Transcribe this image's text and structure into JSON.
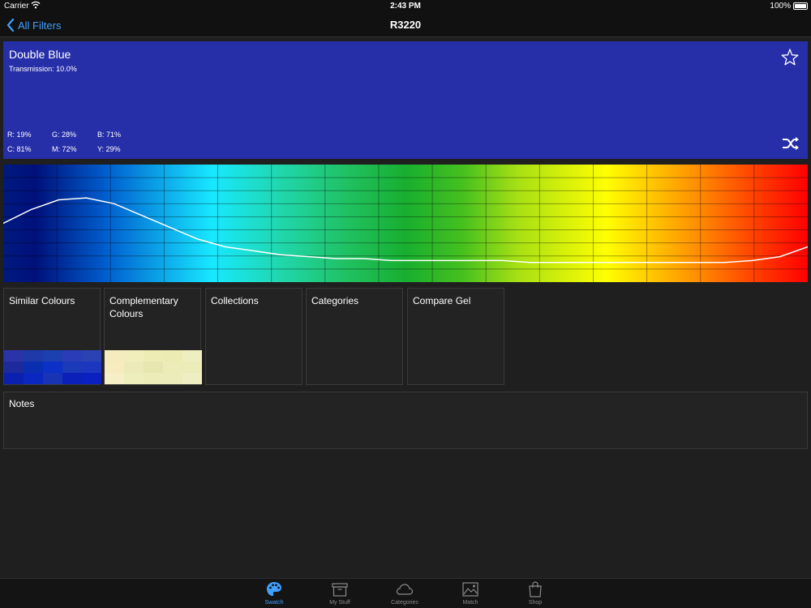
{
  "status_bar": {
    "carrier": "Carrier",
    "time": "2:43 PM",
    "battery": "100%"
  },
  "nav": {
    "back_label": "All Filters",
    "title": "R3220"
  },
  "swatch": {
    "name": "Double Blue",
    "transmission": "Transmission: 10.0%",
    "color": "#262ea8",
    "values": {
      "r": "R: 19%",
      "g": "G: 28%",
      "b": "B: 71%",
      "c": "C: 81%",
      "m": "M: 72%",
      "y": "Y: 29%"
    }
  },
  "spectrum": {
    "transmission_curve": [
      30,
      37,
      42,
      43,
      40,
      34,
      28,
      22,
      18,
      16,
      14,
      13,
      12,
      12,
      11,
      11,
      11,
      11,
      11,
      10,
      10,
      10,
      10,
      10,
      10,
      10,
      10,
      11,
      13,
      18
    ]
  },
  "tiles": [
    {
      "label": "Similar Colours"
    },
    {
      "label": "Complementary Colours"
    },
    {
      "label": "Collections"
    },
    {
      "label": "Categories"
    },
    {
      "label": "Compare Gel"
    }
  ],
  "similar_colours": [
    "#2a34a8",
    "#1e3aa8",
    "#1c40b0",
    "#2a3cb8",
    "#2a42b4",
    "#1c2a9c",
    "#0a2eb0",
    "#0c30c8",
    "#1a3ab8",
    "#1c36c0",
    "#0c20b0",
    "#0a28c0",
    "#1834b4",
    "#0a20b8",
    "#0a20c0"
  ],
  "complementary_colours": [
    "#f4ecbc",
    "#f2eebc",
    "#ececb4",
    "#ecebb4",
    "#eeeec0",
    "#f6ecc0",
    "#eceab8",
    "#e6e6b0",
    "#ececb8",
    "#ececb8",
    "#f6eec6",
    "#eeeebc",
    "#ececb8",
    "#ececba",
    "#eeeec2"
  ],
  "notes": {
    "label": "Notes"
  },
  "tabs": [
    {
      "label": "Swatch",
      "active": true,
      "icon": "palette-icon"
    },
    {
      "label": "My Stuff",
      "active": false,
      "icon": "box-icon"
    },
    {
      "label": "Categories",
      "active": false,
      "icon": "cloud-icon"
    },
    {
      "label": "Match",
      "active": false,
      "icon": "image-icon"
    },
    {
      "label": "Shop",
      "active": false,
      "icon": "bag-icon"
    }
  ],
  "colors": {
    "accent": "#3fa0ff",
    "background": "#1f1f1f"
  }
}
